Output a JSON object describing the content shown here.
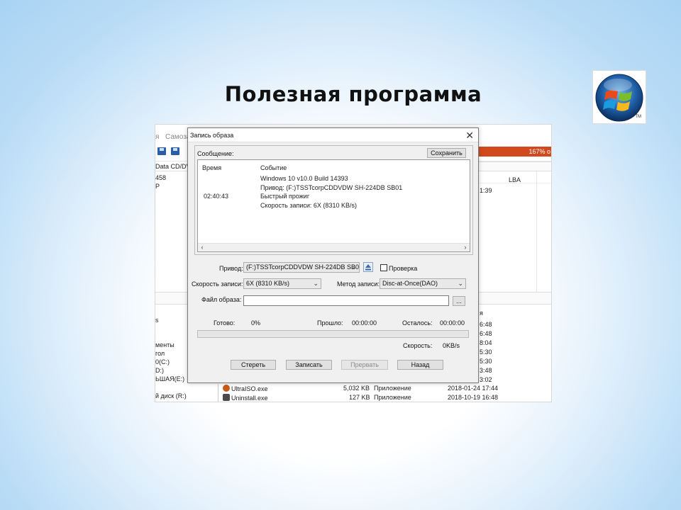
{
  "slide": {
    "title": "Полезная программа",
    "logo_tm": "TM"
  },
  "background_app": {
    "menu": [
      "я",
      "Самоза"
    ],
    "progress_text": "167% о",
    "path": "Data CD/DVD",
    "left_top": [
      "458",
      "P"
    ],
    "col_lba": "LBA",
    "right_col_top": "1:39",
    "left_bottom": [
      "s",
      "менты",
      "гол",
      "0(C:)",
      "D:)",
      "ЬШАЯ(E:)",
      "й диск (R:)"
    ],
    "right_col_bottom": [
      "я",
      "6:48",
      "6:48",
      "8:04",
      "5:30",
      "5:30",
      "3:48",
      "3:02"
    ],
    "files": [
      {
        "name": "UltraISO.exe",
        "size": "5,032 KB",
        "type": "Приложение",
        "date": "2018-01-24 17:44",
        "icon": "disc-icon"
      },
      {
        "name": "Uninstall.exe",
        "size": "127 KB",
        "type": "Приложение",
        "date": "2018-10-19 16:48",
        "icon": "app-icon"
      }
    ]
  },
  "dialog": {
    "title": "Запись образа",
    "message_label": "Сообщение:",
    "save_button": "Сохранить",
    "log": {
      "col_time": "Время",
      "col_event": "Событие",
      "rows": [
        {
          "time": "",
          "event": "Windows 10 v10.0 Build 14393"
        },
        {
          "time": "",
          "event": "Привод: (F:)TSSTcorpCDDVDW SH-224DB SB01"
        },
        {
          "time": "02:40:43",
          "event": "Быстрый прожиг"
        },
        {
          "time": "",
          "event": "Скорость записи: 6X (8310 KB/s)"
        }
      ]
    },
    "drive_label": "Привод:",
    "drive_value": "(F:)TSSTcorpCDDVDW SH-224DB SB01",
    "verify_label": "Проверка",
    "speed_label": "Скорость записи:",
    "speed_value": "6X (8310 KB/s)",
    "method_label": "Метод записи:",
    "method_value": "Disc-at-Once(DAO)",
    "image_label": "Файл образа:",
    "image_value": "",
    "browse_button": "...",
    "done_label": "Готово:",
    "done_value": "0%",
    "elapsed_label": "Прошло:",
    "elapsed_value": "00:00:00",
    "remaining_label": "Осталось:",
    "remaining_value": "00:00:00",
    "progress_fraction": 0,
    "speed_now_label": "Скорость:",
    "speed_now_value": "0KB/s",
    "buttons": {
      "erase": "Стереть",
      "write": "Записать",
      "abort": "Прервать",
      "back": "Назад"
    }
  }
}
